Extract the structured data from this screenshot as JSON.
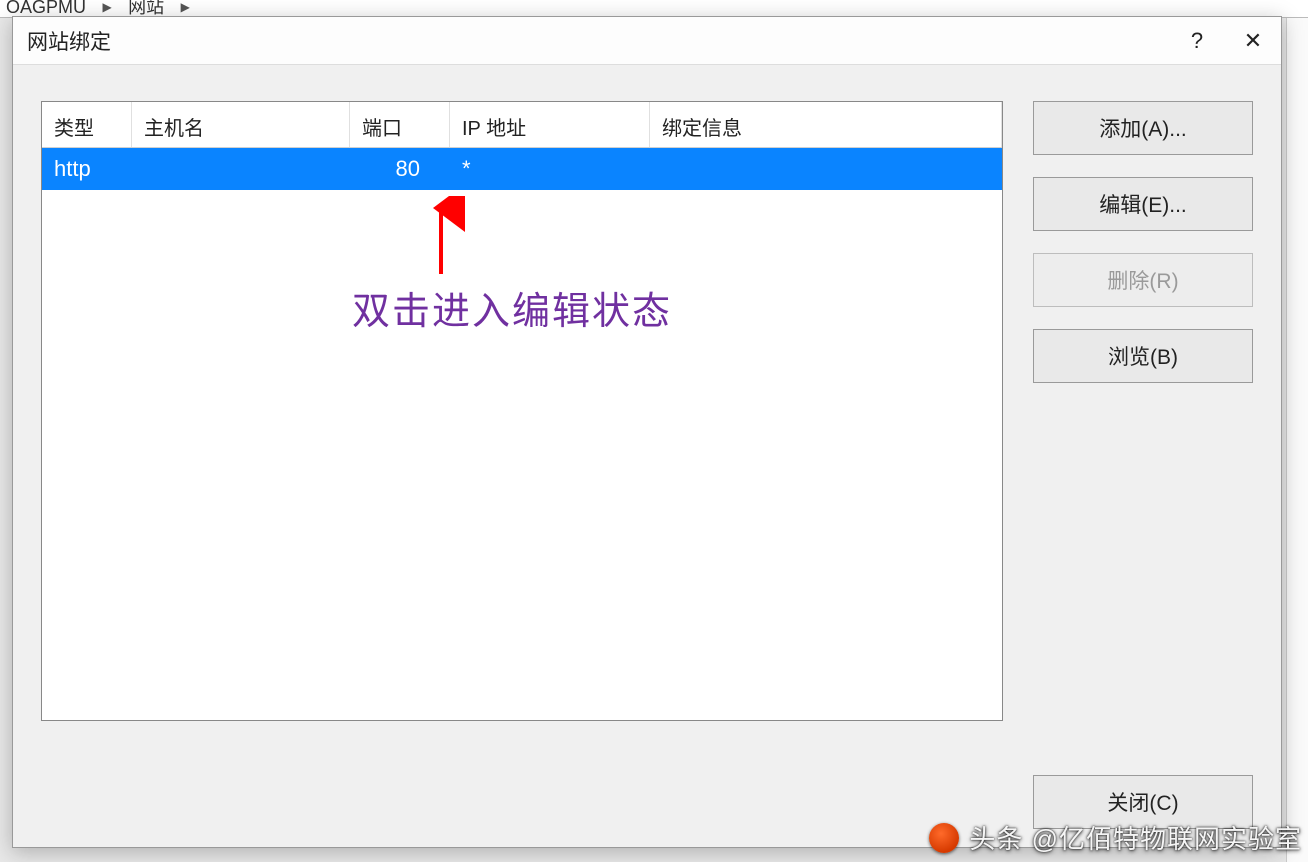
{
  "backdrop": {
    "crumb1": "OAGPMU",
    "crumb2": "网站"
  },
  "dialog": {
    "title": "网站绑定",
    "help_label": "?",
    "close_label": "✕"
  },
  "list": {
    "headers": {
      "type": "类型",
      "host": "主机名",
      "port": "端口",
      "ip": "IP 地址",
      "info": "绑定信息"
    },
    "rows": [
      {
        "type": "http",
        "host": "",
        "port": "80",
        "ip": "*",
        "info": ""
      }
    ]
  },
  "buttons": {
    "add": "添加(A)...",
    "edit": "编辑(E)...",
    "delete": "删除(R)",
    "browse": "浏览(B)",
    "close": "关闭(C)"
  },
  "annotation": {
    "text": "双击进入编辑状态"
  },
  "watermark": {
    "text": "头条 @亿佰特物联网实验室"
  }
}
